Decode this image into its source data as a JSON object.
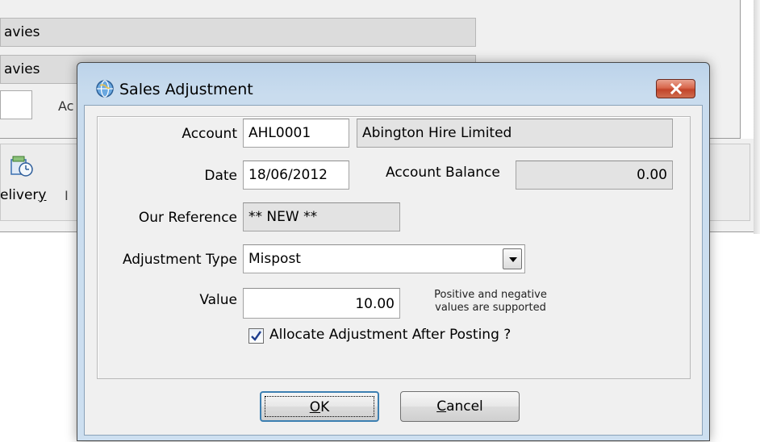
{
  "background": {
    "field1": "avies",
    "field2": "avies",
    "label_fragment": "Ac",
    "delivery_label": "elivery",
    "delivery_accel": "y",
    "toolbar_fragment": "I"
  },
  "dialog": {
    "title": "Sales Adjustment",
    "account": {
      "label": "Account",
      "code": "AHL0001",
      "name": "Abington Hire Limited"
    },
    "date": {
      "label": "Date",
      "value": "18/06/2012"
    },
    "balance": {
      "label": "Account Balance",
      "value": "0.00"
    },
    "reference": {
      "label": "Our Reference",
      "value": "** NEW **"
    },
    "adjustment_type": {
      "label": "Adjustment Type",
      "selected": "Mispost"
    },
    "value": {
      "label": "Value",
      "amount": "10.00",
      "hint_line1": "Positive and negative",
      "hint_line2": "values are supported"
    },
    "allocate": {
      "label": "Allocate Adjustment After Posting ?",
      "checked": true
    },
    "buttons": {
      "ok_accel": "O",
      "ok_rest": "K",
      "cancel_accel": "C",
      "cancel_rest": "ancel"
    }
  },
  "colors": {
    "title_bar": "#c9dcee",
    "close_button": "#c2452a",
    "readonly_field": "#e3e3e3",
    "check_mark": "#1f3f8f"
  }
}
